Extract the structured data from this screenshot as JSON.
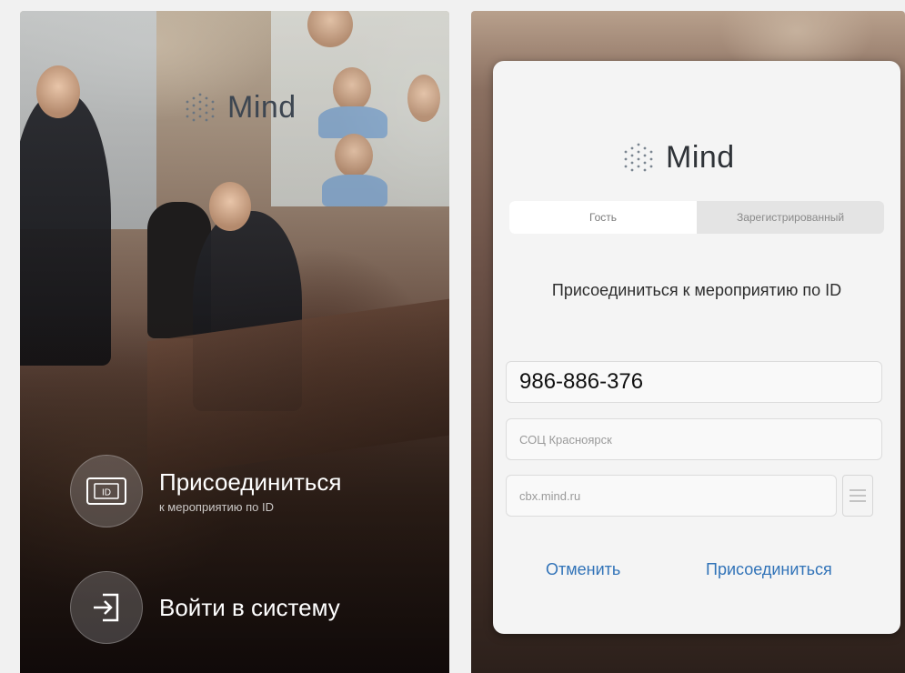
{
  "brand": {
    "name": "Mind"
  },
  "left_screen": {
    "join_action": {
      "title": "Присоединиться",
      "subtitle": "к мероприятию по ID",
      "icon_text": "ID"
    },
    "login_action": {
      "title": "Войти в систему"
    }
  },
  "join_dialog": {
    "tabs": [
      {
        "label": "Гость",
        "active": true
      },
      {
        "label": "Зарегистрированный",
        "active": false
      }
    ],
    "heading": "Присоединиться к мероприятию по ID",
    "conference_id": {
      "value": "986-886-376"
    },
    "display_name": {
      "value": "СОЦ Красноярск"
    },
    "server": {
      "value": "cbx.mind.ru"
    },
    "buttons": {
      "cancel": "Отменить",
      "join": "Присоединиться"
    }
  },
  "colors": {
    "accent": "#3173b8",
    "logo_text": "#3d4651",
    "dialog_bg": "#f4f4f4"
  }
}
